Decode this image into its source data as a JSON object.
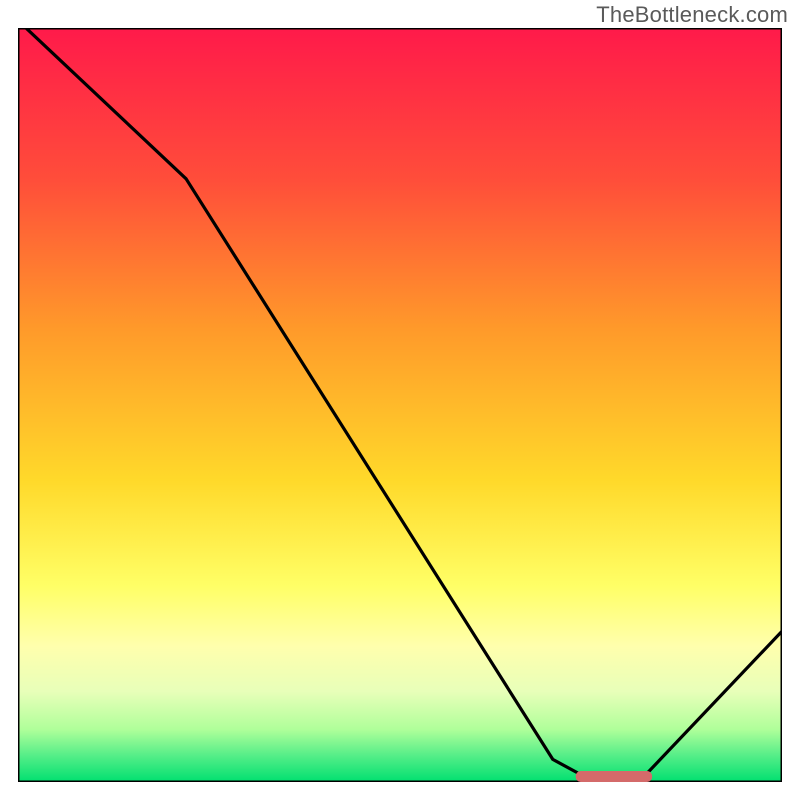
{
  "watermark": "TheBottleneck.com",
  "chart_data": {
    "type": "line",
    "title": "",
    "xlabel": "",
    "ylabel": "",
    "xlim": [
      0,
      100
    ],
    "ylim": [
      0,
      100
    ],
    "gradient_stops": [
      {
        "offset": 0.0,
        "color": "#ff1a4a"
      },
      {
        "offset": 0.2,
        "color": "#ff4d3a"
      },
      {
        "offset": 0.4,
        "color": "#ff9a2a"
      },
      {
        "offset": 0.6,
        "color": "#ffd92a"
      },
      {
        "offset": 0.74,
        "color": "#ffff66"
      },
      {
        "offset": 0.82,
        "color": "#ffffad"
      },
      {
        "offset": 0.88,
        "color": "#e8ffb9"
      },
      {
        "offset": 0.93,
        "color": "#b0ff9a"
      },
      {
        "offset": 0.965,
        "color": "#55ee88"
      },
      {
        "offset": 1.0,
        "color": "#00e070"
      }
    ],
    "curve_points": [
      {
        "x": 0,
        "y": 101
      },
      {
        "x": 22,
        "y": 80
      },
      {
        "x": 70,
        "y": 3
      },
      {
        "x": 74,
        "y": 0.8
      },
      {
        "x": 82,
        "y": 0.8
      },
      {
        "x": 100,
        "y": 20
      }
    ],
    "optimum_marker": {
      "x_start": 73,
      "x_end": 83,
      "y": 0.8,
      "color": "#d46a6a"
    }
  }
}
